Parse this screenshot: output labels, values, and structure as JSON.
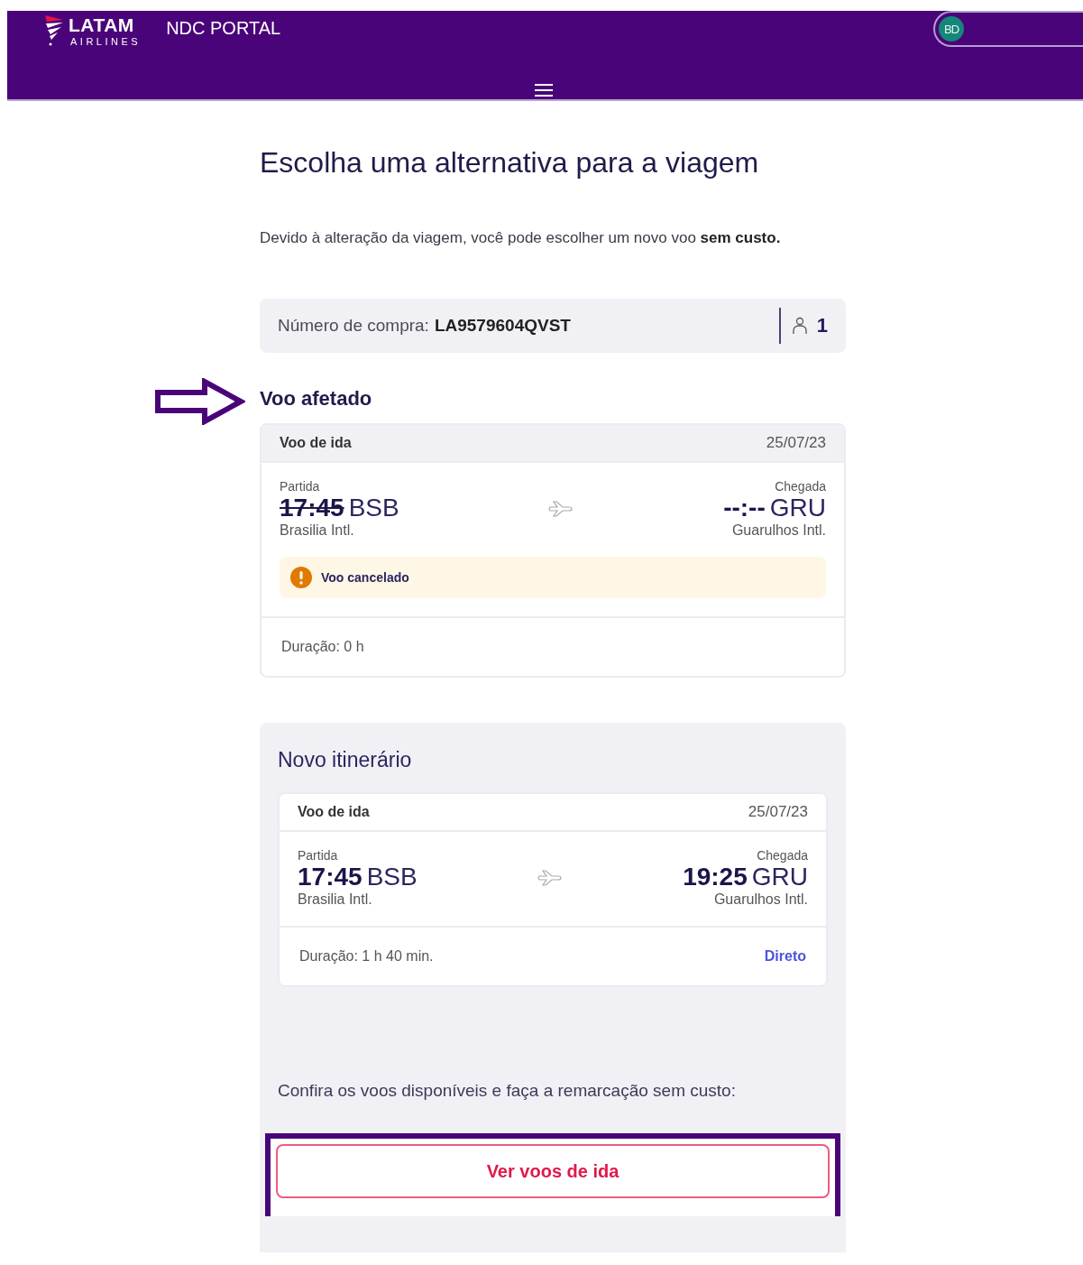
{
  "header": {
    "brand": "LATAM",
    "brand_sub": "AIRLINES",
    "portal": "NDC PORTAL",
    "user_initials": "BD"
  },
  "title": "Escolha uma alternativa para a viagem",
  "intro": "Devido à alteração da viagem, você pode escolher um novo voo **sem custo.**",
  "purchase": {
    "label": "Número de compra:",
    "code": "LA9579604QVST",
    "passengers": "1"
  },
  "affected": {
    "heading": "Voo afetado",
    "flight": {
      "label": "Voo de ida",
      "date": "25/07/23",
      "departure": {
        "label": "Partida",
        "time": "17:45",
        "code": "BSB",
        "airport": "Brasilia Intl.",
        "struck": true
      },
      "arrival": {
        "label": "Chegada",
        "time": "--:--",
        "code": "GRU",
        "airport": "Guarulhos Intl.",
        "struck": false
      },
      "alert": "Voo cancelado",
      "duration": "Duração: 0 h"
    }
  },
  "new_itinerary": {
    "heading": "Novo itinerário",
    "flight": {
      "label": "Voo de ida",
      "date": "25/07/23",
      "departure": {
        "label": "Partida",
        "time": "17:45",
        "code": "BSB",
        "airport": "Brasilia Intl.",
        "struck": false
      },
      "arrival": {
        "label": "Chegada",
        "time": "19:25",
        "code": "GRU",
        "airport": "Guarulhos Intl.",
        "struck": false
      },
      "duration": "Duração: 1 h 40 min.",
      "stops": "Direto"
    },
    "cta_text": "Confira os voos disponíveis e faça a remarcação sem custo:",
    "button": "Ver voos de ida"
  }
}
